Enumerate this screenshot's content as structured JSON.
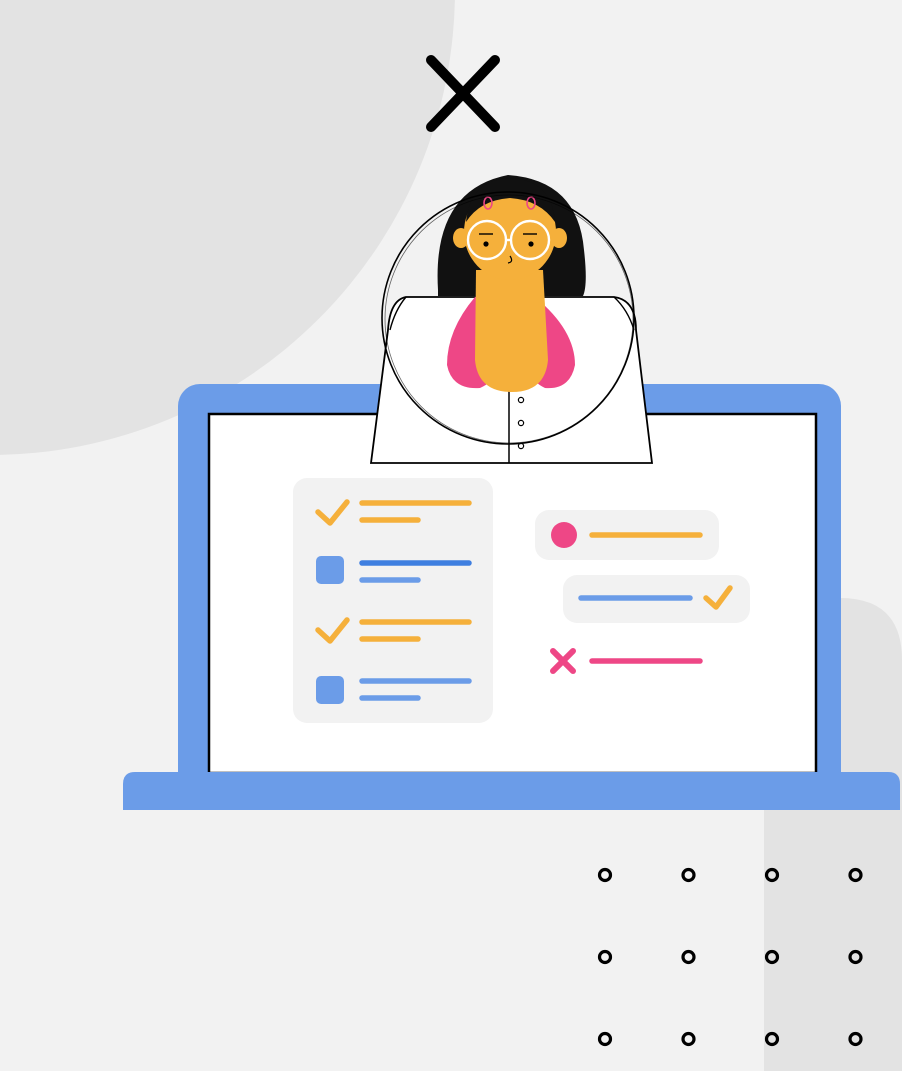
{
  "illustration": {
    "subject": "person-with-checklist-on-laptop",
    "icons": [
      "close-icon",
      "check-icon",
      "checkbox-icon",
      "status-dot-icon",
      "cross-icon"
    ]
  },
  "colors": {
    "background": "#f2f2f2",
    "background_shape": "#e3e3e3",
    "laptop_body": "#6b9ce8",
    "screen": "#ffffff",
    "outline": "#000000",
    "accent_yellow": "#f5b03b",
    "accent_blue": "#6b9ce8",
    "accent_blue_dark": "#3f7fe0",
    "accent_pink": "#ee4786",
    "skin": "#f5b03b",
    "hair": "#111111",
    "card": "#f2f2f2"
  },
  "checklist": [
    {
      "state": "checked"
    },
    {
      "state": "unchecked"
    },
    {
      "state": "checked"
    },
    {
      "state": "unchecked"
    }
  ],
  "status_list": [
    {
      "status": "pending"
    },
    {
      "status": "done"
    },
    {
      "status": "rejected"
    }
  ],
  "dot_grid": {
    "rows": 3,
    "cols": 4
  }
}
